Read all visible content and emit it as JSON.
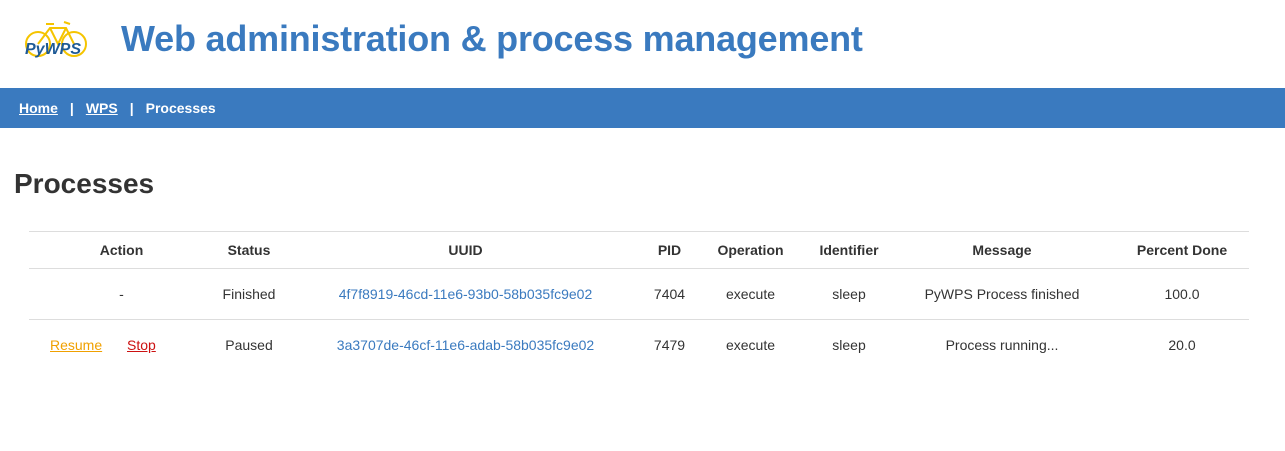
{
  "header": {
    "logo_text": "PyWPS",
    "title": "Web administration & process management"
  },
  "breadcrumb": {
    "items": [
      {
        "label": "Home",
        "link": true
      },
      {
        "label": "WPS",
        "link": true
      },
      {
        "label": "Processes",
        "link": false
      }
    ],
    "separator": "|"
  },
  "page_title": "Processes",
  "table": {
    "columns": [
      "Action",
      "Status",
      "UUID",
      "PID",
      "Operation",
      "Identifier",
      "Message",
      "Percent Done"
    ],
    "rows": [
      {
        "action": "-",
        "status": "Finished",
        "uuid": "4f7f8919-46cd-11e6-93b0-58b035fc9e02",
        "pid": "7404",
        "operation": "execute",
        "identifier": "sleep",
        "message": "PyWPS Process finished",
        "percent_done": "100.0"
      },
      {
        "actions": [
          "Resume",
          "Stop"
        ],
        "status": "Paused",
        "uuid": "3a3707de-46cf-11e6-adab-58b035fc9e02",
        "pid": "7479",
        "operation": "execute",
        "identifier": "sleep",
        "message": "Process running...",
        "percent_done": "20.0"
      }
    ]
  },
  "colors": {
    "brand_blue": "#3a7abf",
    "resume": "#f0a000",
    "stop": "#cc1111",
    "logo_yellow": "#f5c400"
  },
  "icons": {
    "logo": "pywps-bicycle-logo"
  }
}
